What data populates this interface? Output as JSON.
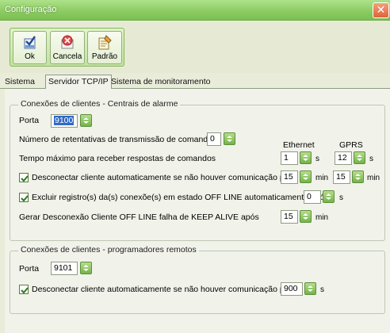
{
  "window": {
    "title": "Configuração",
    "close_glyph": "✕"
  },
  "toolbar": {
    "ok_label": "Ok",
    "ok_icon": "checkmark-icon",
    "cancel_label": "Cancela",
    "cancel_icon": "cancel-icon",
    "default_label": "Padrão",
    "default_icon": "notepad-icon"
  },
  "tabs": [
    {
      "label": "Sistema",
      "active": false
    },
    {
      "label": "Servidor TCP/IP",
      "active": true
    },
    {
      "label": "Sistema de monitoramento",
      "active": false
    }
  ],
  "alarm_group": {
    "title": "Conexões de clientes - Centrais de alarme",
    "porta_label": "Porta",
    "porta_value": "9100",
    "retries_label": "Número de retentativas de transmissão de comandos",
    "retries_value": "0",
    "ethernet_header": "Ethernet",
    "gprs_header": "GPRS",
    "timeout_label": "Tempo máximo para receber respostas de comandos",
    "timeout_ethernet": "1",
    "timeout_ethernet_unit": "s",
    "timeout_gprs": "12",
    "timeout_gprs_unit": "s",
    "disconnect_label": "Desconectar cliente automaticamente se não houver comunicação por",
    "disconnect_checked": true,
    "disconnect_ethernet": "15",
    "disconnect_ethernet_unit": "min",
    "disconnect_gprs": "15",
    "disconnect_gprs_unit": "min",
    "offline_label": "Excluir registro(s) da(s) conexõe(s) em estado OFF LINE automaticamente após",
    "offline_checked": true,
    "offline_value": "0",
    "offline_unit": "s",
    "keepalive_label": "Gerar Desconexão Cliente OFF LINE falha de KEEP ALIVE após",
    "keepalive_value": "15",
    "keepalive_unit": "min"
  },
  "remote_group": {
    "title": "Conexões de clientes - programadores remotos",
    "porta_label": "Porta",
    "porta_value": "9101",
    "disconnect_label": "Desconectar cliente automaticamente se não houver comunicação por",
    "disconnect_checked": true,
    "disconnect_value": "900",
    "disconnect_unit": "s"
  },
  "colors": {
    "titlebar": "#8dcc63",
    "spin_button": "#74b34a",
    "selection": "#316ac5"
  }
}
